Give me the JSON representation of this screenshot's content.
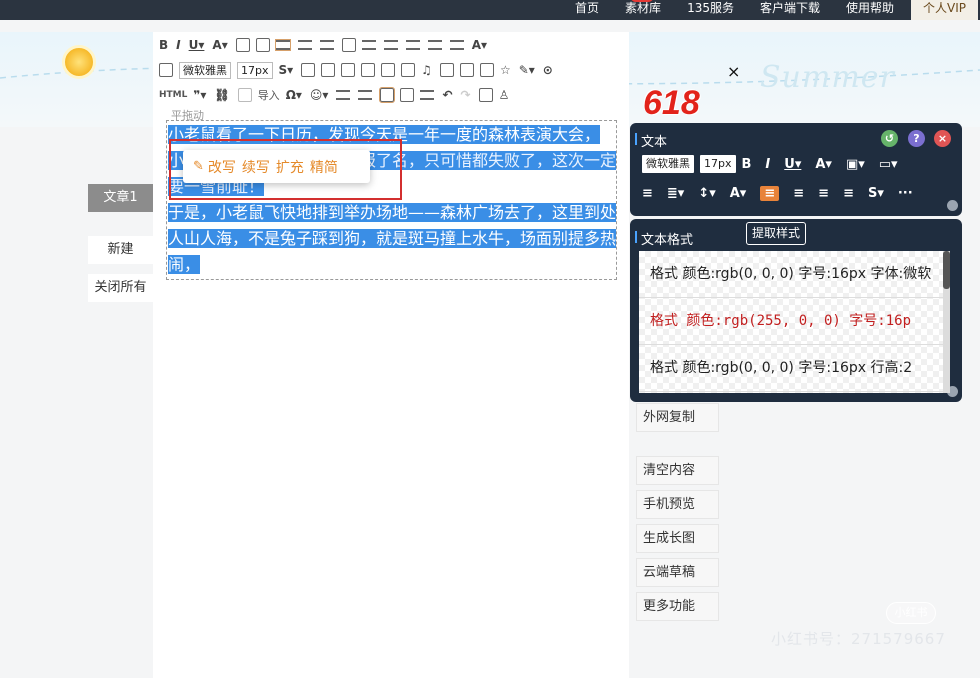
{
  "topnav": {
    "items": [
      "首页",
      "素材库",
      "135服务",
      "客户端下载",
      "使用帮助"
    ],
    "vip": "个人VIP"
  },
  "banner": {
    "summer": "Summer",
    "promo": "618",
    "close": "×"
  },
  "left": {
    "article_tab": "文章1",
    "new": "新建",
    "close_all": "关闭所有"
  },
  "editor": {
    "toolbar": {
      "font": "微软雅黑",
      "size": "17px",
      "html": "HTML",
      "import": "导入"
    },
    "faint": "平拖动",
    "paragraph1": "小老鼠看了一下日历，发现今天是一年一度的森林表演大会，小",
    "paragraph1_b": "……………………娱，还报了名，只可惜都失败了，这次一定要一雪前耻！",
    "paragraph2": "于是，小老鼠飞快地排到举办场地——森林广场去了，这里到处人山人海，不是兔子踩到狗，就是斑马撞上水牛，场面别提多热闹，",
    "ai_options": [
      "改写",
      "续写",
      "扩充",
      "精简"
    ]
  },
  "right_buttons": [
    "外网复制",
    "清空内容",
    "手机预览",
    "生成长图",
    "云端草稿",
    "更多功能"
  ],
  "text_panel": {
    "title": "文本",
    "font": "微软雅黑",
    "size": "17px"
  },
  "style_panel": {
    "title": "文本格式",
    "extract": "提取样式",
    "items": [
      "格式 颜色:rgb(0, 0, 0) 字号:16px 字体:微软",
      "格式 颜色:rgb(255, 0, 0) 字号:16p",
      "格式 颜色:rgb(0, 0, 0) 字号:16px 行高:2"
    ]
  },
  "watermark": {
    "badge": "小红书",
    "id": "小红书号：271579667"
  },
  "colors": {
    "nav_bg": "#2b3440",
    "panel_bg": "#1f2d3f",
    "selection": "#3a8ee6",
    "accent_orange": "#e8833a",
    "red": "#d32f2f"
  }
}
